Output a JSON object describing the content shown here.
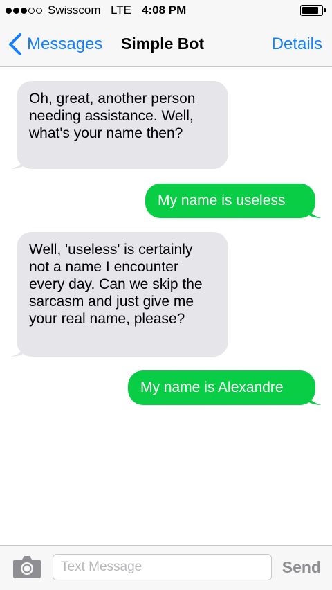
{
  "status_bar": {
    "signal_dots": [
      true,
      true,
      true,
      false,
      false
    ],
    "carrier": "Swisscom",
    "network": "LTE",
    "time": "4:08 PM",
    "battery_level": 0.85
  },
  "nav": {
    "back_label": "Messages",
    "title": "Simple Bot",
    "details_label": "Details"
  },
  "messages": [
    {
      "direction": "incoming",
      "text": "Oh, great, another person needing assistance. Well, what's your name then?"
    },
    {
      "direction": "outgoing",
      "text": "My name is useless"
    },
    {
      "direction": "incoming",
      "text": "Well, 'useless' is certainly not a name I encounter every day. Can we skip the sarcasm and just give me your real name, please?"
    },
    {
      "direction": "outgoing",
      "text": "My name is Alexandre"
    }
  ],
  "input": {
    "placeholder": "Text Message",
    "value": "",
    "send_label": "Send"
  },
  "colors": {
    "accent": "#157efb",
    "outgoing_bubble": "#09cd45",
    "incoming_bubble": "#e5e5ea",
    "send_disabled": "#8e8e93"
  },
  "icons": {
    "back": "chevron-left-icon",
    "camera": "camera-icon"
  }
}
